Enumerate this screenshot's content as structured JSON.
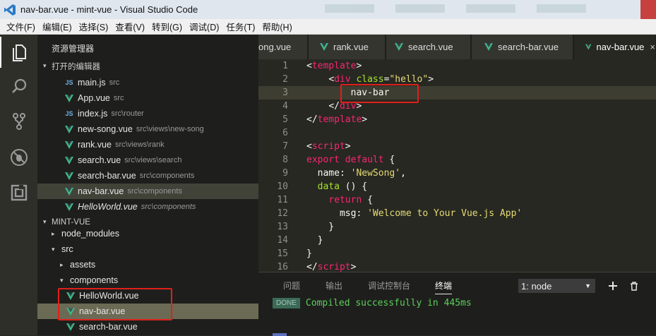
{
  "window": {
    "title": "nav-bar.vue - mint-vue - Visual Studio Code",
    "app_icon": "vscode-icon"
  },
  "menu": [
    "文件(F)",
    "编辑(E)",
    "选择(S)",
    "查看(V)",
    "转到(G)",
    "调试(D)",
    "任务(T)",
    "帮助(H)"
  ],
  "activity_bar": [
    "files-icon",
    "search-icon",
    "source-control-icon",
    "debug-icon",
    "extensions-icon"
  ],
  "sidebar": {
    "title": "资源管理器",
    "open_editors": {
      "label": "打开的编辑器",
      "items": [
        {
          "name": "main.js",
          "path": "src",
          "icon": "js"
        },
        {
          "name": "App.vue",
          "path": "src",
          "icon": "vue"
        },
        {
          "name": "index.js",
          "path": "src\\router",
          "icon": "js"
        },
        {
          "name": "new-song.vue",
          "path": "src\\views\\new-song",
          "icon": "vue"
        },
        {
          "name": "rank.vue",
          "path": "src\\views\\rank",
          "icon": "vue"
        },
        {
          "name": "search.vue",
          "path": "src\\views\\search",
          "icon": "vue"
        },
        {
          "name": "search-bar.vue",
          "path": "src\\components",
          "icon": "vue"
        },
        {
          "name": "nav-bar.vue",
          "path": "src\\components",
          "icon": "vue",
          "selected": true
        },
        {
          "name": "HelloWorld.vue",
          "path": "src\\components",
          "icon": "vue",
          "italic": true
        }
      ]
    },
    "project": {
      "label": "MINT-VUE",
      "tree": [
        {
          "name": "node_modules",
          "caret": "▸"
        },
        {
          "name": "src",
          "caret": "▾"
        },
        {
          "name": "assets",
          "caret": "▸"
        },
        {
          "name": "components",
          "caret": "▾"
        },
        {
          "name": "HelloWorld.vue",
          "icon": "vue"
        },
        {
          "name": "nav-bar.vue",
          "icon": "vue",
          "selected": true
        },
        {
          "name": "search-bar.vue",
          "icon": "vue"
        }
      ]
    }
  },
  "tabs": [
    {
      "label": "ong.vue"
    },
    {
      "label": "rank.vue"
    },
    {
      "label": "search.vue"
    },
    {
      "label": "search-bar.vue"
    },
    {
      "label": "nav-bar.vue",
      "active": true,
      "close": "×"
    }
  ],
  "editor": {
    "lines": [
      {
        "n": "1",
        "html": "<span class='t-pun'>&lt;</span><span class='t-tag'>template</span><span class='t-pun'>&gt;</span>"
      },
      {
        "n": "2",
        "html": "    <span class='t-pun'>&lt;</span><span class='t-tag'>div</span> <span class='t-attr'>class</span><span class='t-pun'>=</span><span class='t-str'>\"hello\"</span><span class='t-pun'>&gt;</span>"
      },
      {
        "n": "3",
        "html": "        nav-bar",
        "current": true
      },
      {
        "n": "4",
        "html": "    <span class='t-pun'>&lt;/</span><span class='t-tag'>div</span><span class='t-pun'>&gt;</span>"
      },
      {
        "n": "5",
        "html": "<span class='t-pun'>&lt;/</span><span class='t-tag'>template</span><span class='t-pun'>&gt;</span>"
      },
      {
        "n": "6",
        "html": ""
      },
      {
        "n": "7",
        "html": "<span class='t-pun'>&lt;</span><span class='t-tag'>script</span><span class='t-pun'>&gt;</span>"
      },
      {
        "n": "8",
        "html": "<span class='t-kw'>export</span> <span class='t-kw'>default</span> {"
      },
      {
        "n": "9",
        "html": "  name: <span class='t-str'>'NewSong'</span>,"
      },
      {
        "n": "10",
        "html": "  <span class='t-fn'>data</span> () {"
      },
      {
        "n": "11",
        "html": "    <span class='t-kw'>return</span> {"
      },
      {
        "n": "12",
        "html": "      msg: <span class='t-str'>'Welcome to Your Vue.js App'</span>"
      },
      {
        "n": "13",
        "html": "    }"
      },
      {
        "n": "14",
        "html": "  }"
      },
      {
        "n": "15",
        "html": "}"
      },
      {
        "n": "16",
        "html": "<span class='t-pun'>&lt;/</span><span class='t-tag'>script</span><span class='t-pun'>&gt;</span>"
      }
    ]
  },
  "panel": {
    "tabs": [
      "问题",
      "输出",
      "调试控制台",
      "终端"
    ],
    "active_tab": "终端",
    "terminal_select": "1: node",
    "add_icon": "plus-icon",
    "trash_icon": "trash-icon",
    "badge": "DONE",
    "message": "Compiled successfully in 445ms"
  },
  "colors": {
    "accent_box": "#e0201a",
    "vue_green": "#41b883",
    "terminal_green": "#5ccf5c"
  }
}
